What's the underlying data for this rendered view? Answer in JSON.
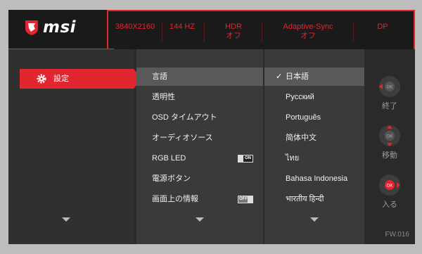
{
  "header": {
    "brand": "msi",
    "items": [
      {
        "line1": "3840X2160",
        "line2": ""
      },
      {
        "line1": "144 HZ",
        "line2": ""
      },
      {
        "line1": "HDR",
        "line2": "オフ"
      },
      {
        "line1": "Adaptive-Sync",
        "line2": "オフ"
      },
      {
        "line1": "DP",
        "line2": ""
      }
    ]
  },
  "main_menu": {
    "selected": "設定"
  },
  "sub_menu": {
    "items": [
      "言語",
      "透明性",
      "OSD タイムアウト",
      "オーディオソース",
      "RGB LED",
      "電源ボタン",
      "画面上の情報"
    ],
    "rgb_led_toggle": "ON",
    "info_toggle": "OFF"
  },
  "options": {
    "check": "✓",
    "items": [
      "日本語",
      "Русский",
      "Português",
      "简体中文",
      "ไทย",
      "Bahasa Indonesia",
      "भारतीय हिन्दी"
    ]
  },
  "nav": {
    "ok": "OK",
    "exit_label": "終了",
    "move_label": "移動",
    "enter_label": "入る"
  },
  "firmware": "FW.016",
  "colors": {
    "accent": "#e2262f",
    "background": "#2b2b2b"
  }
}
